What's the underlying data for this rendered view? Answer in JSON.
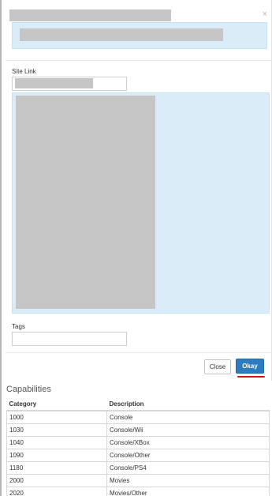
{
  "modal": {
    "close_glyph": "×",
    "site_link_label": "Site Link",
    "tags_label": "Tags",
    "tags_value": ""
  },
  "footer": {
    "close_label": "Close",
    "okay_label": "Okay"
  },
  "capabilities": {
    "heading": "Capabilities",
    "columns": [
      "Category",
      "Description"
    ],
    "rows": [
      [
        "1000",
        "Console"
      ],
      [
        "1030",
        "Console/Wii"
      ],
      [
        "1040",
        "Console/XBox"
      ],
      [
        "1090",
        "Console/Other"
      ],
      [
        "1180",
        "Console/PS4"
      ],
      [
        "2000",
        "Movies"
      ],
      [
        "2020",
        "Movies/Other"
      ]
    ]
  },
  "colors": {
    "accent": "#2c7cc1",
    "info_bg": "#d9ecf7",
    "annotation": "#dd1111"
  }
}
